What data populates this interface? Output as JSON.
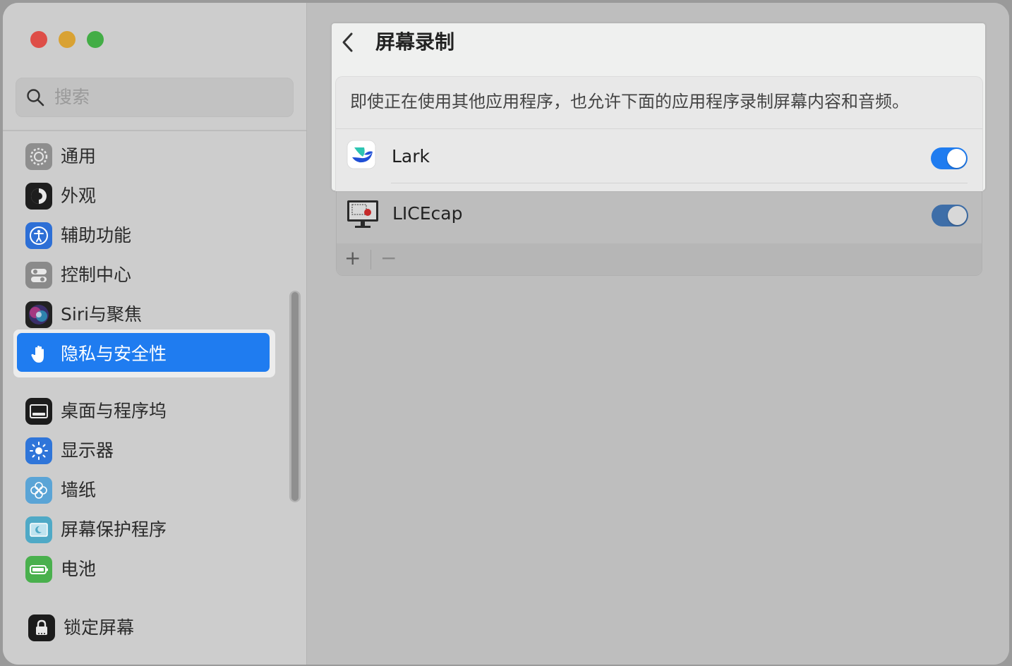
{
  "sidebar": {
    "search_placeholder": "搜索",
    "items": [
      {
        "label": "通用"
      },
      {
        "label": "外观"
      },
      {
        "label": "辅助功能"
      },
      {
        "label": "控制中心"
      },
      {
        "label": "Siri与聚焦"
      },
      {
        "label": "隐私与安全性"
      },
      {
        "label": "桌面与程序坞"
      },
      {
        "label": "显示器"
      },
      {
        "label": "墙纸"
      },
      {
        "label": "屏幕保护程序"
      },
      {
        "label": "电池"
      },
      {
        "label": "锁定屏幕"
      }
    ],
    "selected_index": 5
  },
  "main": {
    "title": "屏幕录制",
    "description": "即使正在使用其他应用程序，也允许下面的应用程序录制屏幕内容和音频。",
    "apps": [
      {
        "name": "Lark",
        "enabled": true
      },
      {
        "name": "LICEcap",
        "enabled": true
      }
    ],
    "add_label": "+",
    "remove_label": "−"
  },
  "colors": {
    "accent": "#1f7cf0",
    "close": "#de4e48",
    "minimize": "#d9a233",
    "zoom": "#43ad46"
  }
}
